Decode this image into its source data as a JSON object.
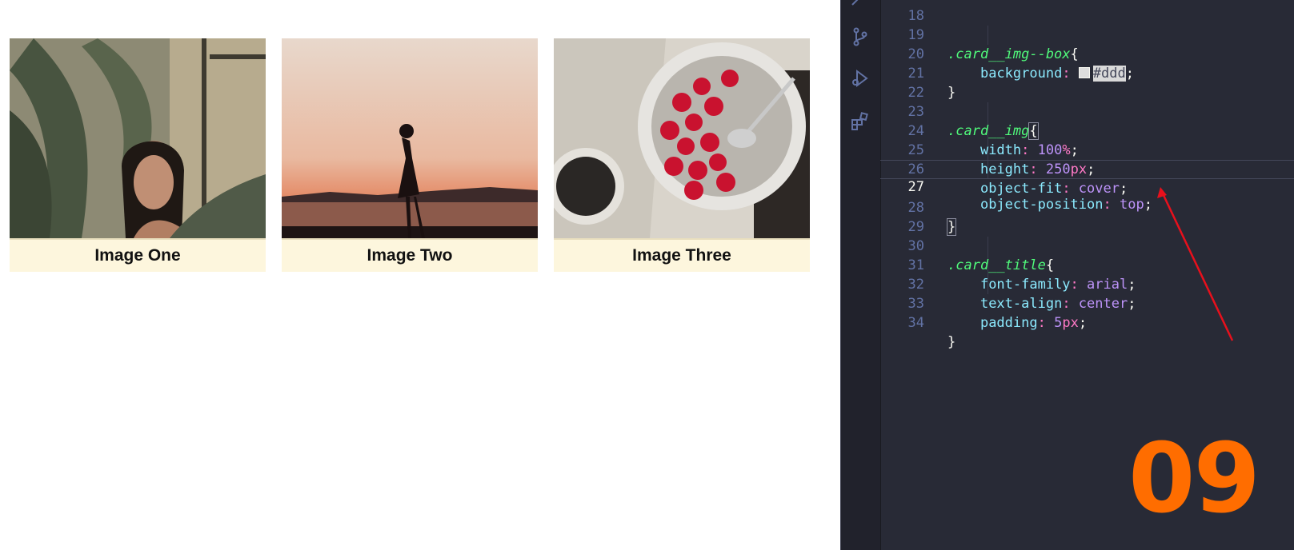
{
  "cards": [
    {
      "title": "Image One"
    },
    {
      "title": "Image Two"
    },
    {
      "title": "Image Three"
    }
  ],
  "editor": {
    "lines": [
      {
        "n": "18"
      },
      {
        "n": "19"
      },
      {
        "n": "20"
      },
      {
        "n": "21"
      },
      {
        "n": "22"
      },
      {
        "n": "23"
      },
      {
        "n": "24"
      },
      {
        "n": "25"
      },
      {
        "n": "26"
      },
      {
        "n": "27"
      },
      {
        "n": "28"
      },
      {
        "n": "29"
      },
      {
        "n": "30"
      },
      {
        "n": "31"
      },
      {
        "n": "32"
      },
      {
        "n": "33"
      },
      {
        "n": "34"
      }
    ],
    "code": {
      "sel1": ".card__img--box",
      "p_background": "background",
      "v_background": "#ddd",
      "sel2": ".card__img",
      "p_width": "width",
      "v_width_num": "100",
      "v_width_unit": "%",
      "p_height": "height",
      "v_height_num": "250",
      "v_height_unit": "px",
      "p_fit": "object-fit",
      "v_fit": "cover",
      "p_pos": "object-position",
      "v_pos": "top",
      "sel3": ".card__title",
      "p_font": "font-family",
      "v_font": "arial",
      "p_align": "text-align",
      "v_align": "center",
      "p_padding": "padding",
      "v_padding_num": "5",
      "v_padding_unit": "px"
    },
    "overlay_number": "09",
    "accent": "#ff6d00",
    "icons": [
      "search-icon",
      "source-control-icon",
      "run-debug-icon",
      "extensions-icon"
    ]
  }
}
